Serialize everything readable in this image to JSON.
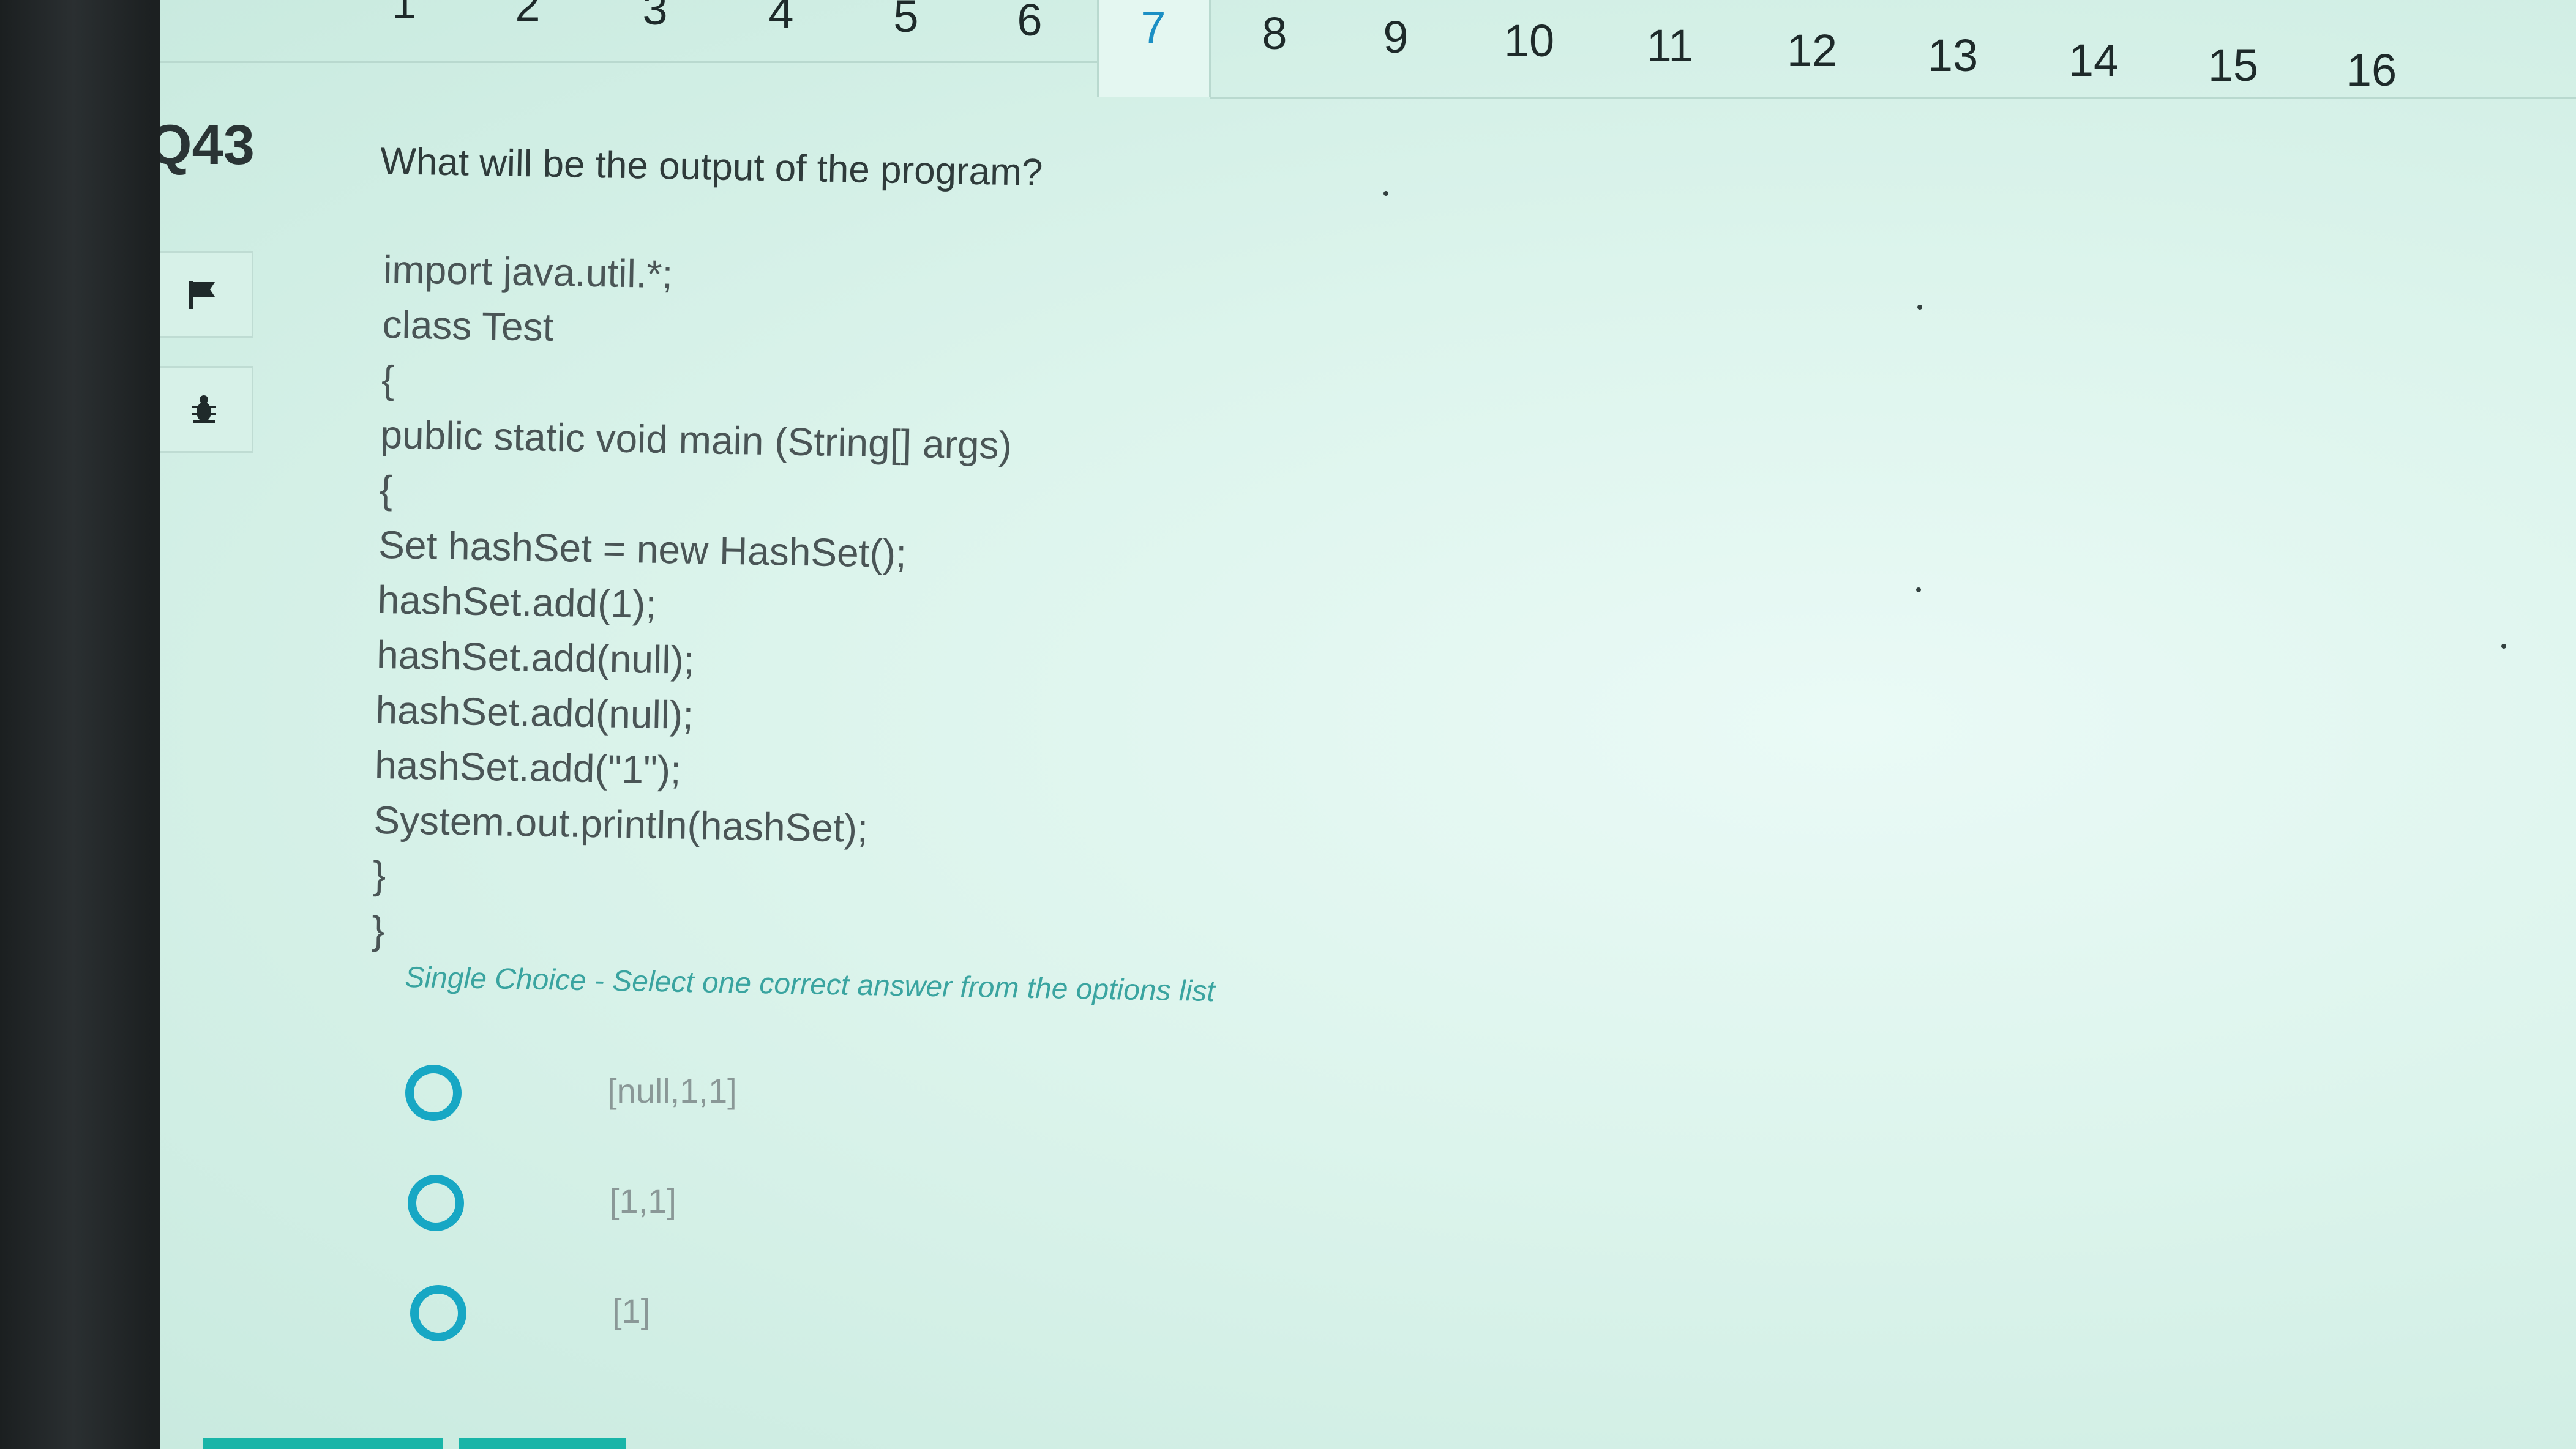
{
  "navigation": {
    "questions": [
      "1",
      "2",
      "3",
      "4",
      "5",
      "6",
      "7",
      "8",
      "9",
      "10",
      "11",
      "12",
      "13",
      "14",
      "15",
      "16"
    ],
    "active": "7"
  },
  "question": {
    "id": "Q43",
    "text": "What will be the output of the program?",
    "code_lines": [
      "import java.util.*;",
      "class Test",
      "{",
      "public static void main (String[] args)",
      "{",
      "Set hashSet = new HashSet();",
      "hashSet.add(1);",
      "hashSet.add(null);",
      "hashSet.add(null);",
      "hashSet.add(\"1\");",
      "System.out.println(hashSet);",
      "}",
      "}"
    ],
    "instruction": "Single Choice - Select one correct answer from the options list",
    "options": [
      "[null,1,1]",
      "[1,1]",
      "[1]"
    ]
  },
  "icons": {
    "flag": "flag-icon",
    "bug": "bug-icon"
  },
  "colors": {
    "accent": "#1b8fc4",
    "radio": "#17a7c4",
    "instruction": "#3aa4a0"
  }
}
